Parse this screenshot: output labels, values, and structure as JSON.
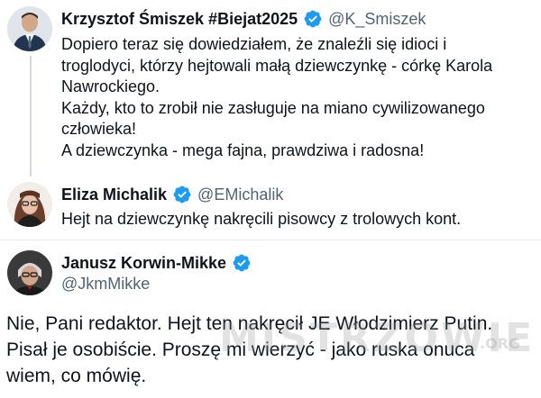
{
  "colors": {
    "verified_badge": "#1d9bf0",
    "handle_text": "#536471",
    "thread_line": "#cfd9de",
    "divider": "#e6ecf0"
  },
  "tweets": [
    {
      "display_name": "Krzysztof Śmiszek #Biejat2025",
      "verified_icon": "verified-badge-icon",
      "handle": "@K_Smiszek",
      "lines": [
        "Dopiero teraz się dowiedziałem, że znaleźli się idioci i",
        "troglodyci, którzy hejtowali małą dziewczynkę - córkę Karola",
        "Nawrockiego.",
        "Każdy, kto to zrobił nie zasługuje na miano cywilizowanego",
        "człowieka!",
        "A dziewczynka - mega fajna, prawdziwa i radosna!"
      ]
    },
    {
      "display_name": "Eliza Michalik",
      "verified_icon": "verified-badge-icon",
      "handle": "@EMichalik",
      "lines": [
        "Hejt na dziewczynkę nakręcili pisowcy z trolowych kont."
      ]
    },
    {
      "display_name": "Janusz Korwin-Mikke",
      "verified_icon": "verified-badge-icon",
      "handle": "@JkmMikke",
      "lines": [
        "Nie, Pani redaktor. Hejt ten nakręcił JE Włodzimierz Putin.",
        "Pisał je osobiście. Proszę mi wierzyć - jako ruska onuca",
        "wiem, co mówię."
      ]
    }
  ],
  "watermark": {
    "main": "MISTRZOWIE",
    "suffix": ".ORG"
  }
}
